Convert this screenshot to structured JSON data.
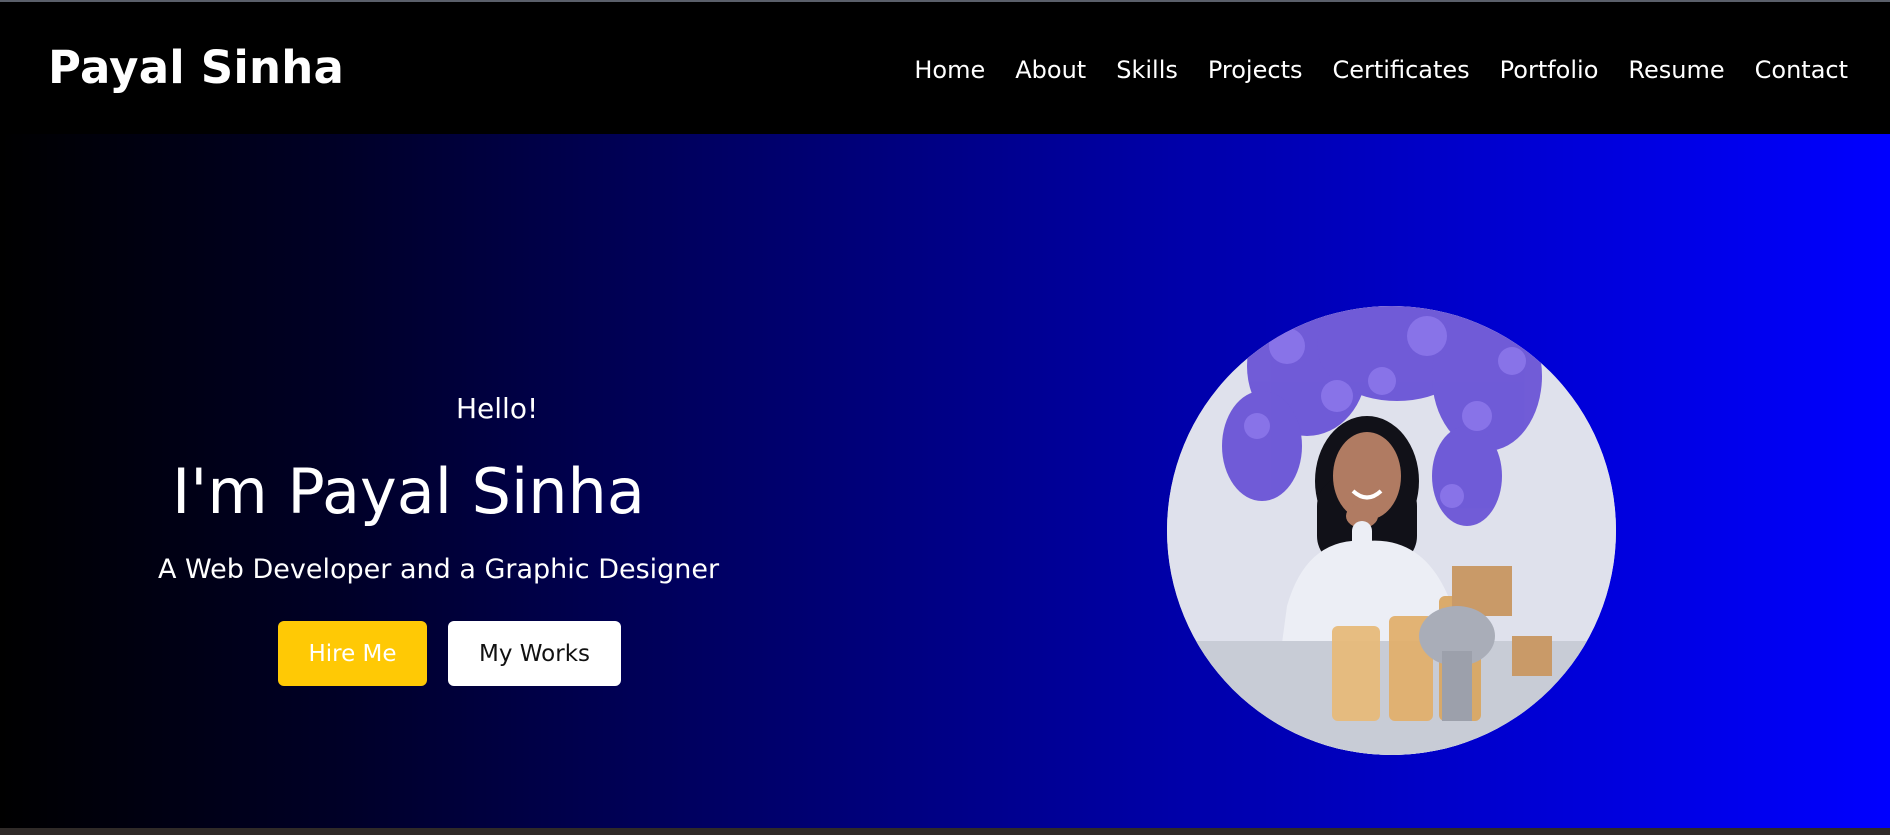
{
  "navbar": {
    "brand": "Payal Sinha",
    "links": [
      "Home",
      "About",
      "Skills",
      "Projects",
      "Certificates",
      "Portfolio",
      "Resume",
      "Contact"
    ]
  },
  "hero": {
    "greeting": "Hello!",
    "name": "I'm Payal Sinha",
    "tagline": "A Web Developer and a Graphic Designer",
    "buttons": {
      "hire": "Hire Me",
      "works": "My Works"
    },
    "portrait_alt": "Portrait of Payal Sinha"
  },
  "colors": {
    "navbar_bg": "#000000",
    "gradient_start": "#000000",
    "gradient_end": "#0000ff",
    "hire_button": "#ffc905",
    "works_button": "#ffffff"
  }
}
